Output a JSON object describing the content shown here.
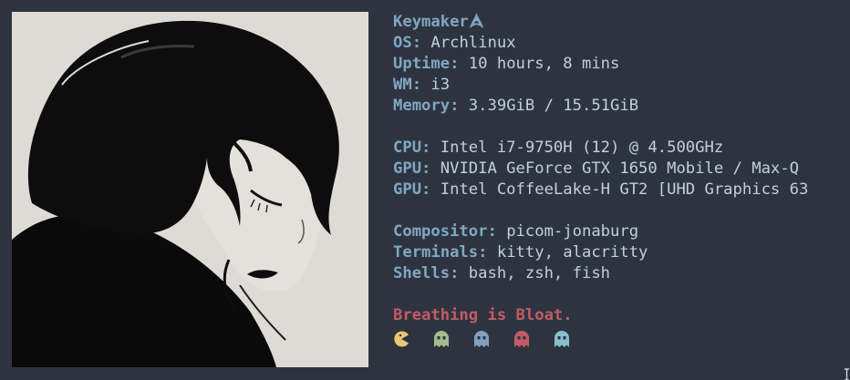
{
  "header": {
    "title": "Keymaker",
    "logo_icon": "arch-linux-icon"
  },
  "group1": [
    {
      "key": "OS",
      "value": "Archlinux"
    },
    {
      "key": "Uptime",
      "value": "10 hours, 8 mins"
    },
    {
      "key": "WM",
      "value": "i3"
    },
    {
      "key": "Memory",
      "value": "3.39GiB / 15.51GiB"
    }
  ],
  "group2": [
    {
      "key": "CPU",
      "value": "Intel i7-9750H (12) @ 4.500GHz"
    },
    {
      "key": "GPU",
      "value": "NVIDIA GeForce GTX 1650 Mobile / Max-Q"
    },
    {
      "key": "GPU",
      "value": "Intel CoffeeLake-H GT2 [UHD Graphics 63"
    }
  ],
  "group3": [
    {
      "key": "Compositor",
      "value": "picom-jonaburg"
    },
    {
      "key": "Terminals",
      "value": "kitty, alacritty"
    },
    {
      "key": "Shells",
      "value": "bash, zsh, fish"
    }
  ],
  "separator": ": ",
  "motto": "Breathing is Bloat.",
  "glyphs": [
    {
      "icon": "pacman-icon",
      "color": "#e8c878"
    },
    {
      "icon": "ghost-icon",
      "color": "#a3be8c"
    },
    {
      "icon": "ghost-icon",
      "color": "#81a1c1"
    },
    {
      "icon": "ghost-icon",
      "color": "#c25b66"
    },
    {
      "icon": "ghost-icon",
      "color": "#88c0d0"
    }
  ],
  "colors": {
    "background": "#2e343f",
    "key": "#80a7c3",
    "value": "#c3cfdb",
    "motto": "#c25b66",
    "artwork_bg": "#dedbd6"
  }
}
